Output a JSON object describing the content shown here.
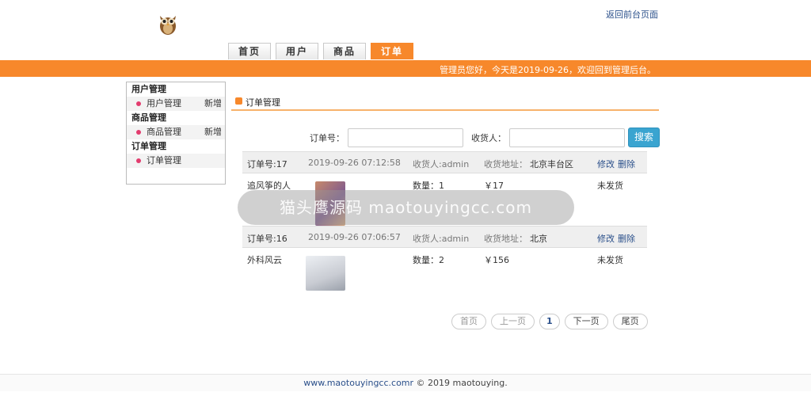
{
  "header": {
    "back_link": "返回前台页面",
    "tabs": [
      {
        "label": "首页",
        "active": false
      },
      {
        "label": "用户",
        "active": false
      },
      {
        "label": "商品",
        "active": false
      },
      {
        "label": "订单",
        "active": true
      }
    ]
  },
  "banner": {
    "greeting": "管理员您好，今天是2019-09-26，欢迎回到管理后台。",
    "color": "#f7882b"
  },
  "sidebar": {
    "sections": [
      {
        "title": "用户管理",
        "items": [
          {
            "label": "用户管理",
            "extra": "新增"
          }
        ]
      },
      {
        "title": "商品管理",
        "items": [
          {
            "label": "商品管理",
            "extra": "新增"
          }
        ]
      },
      {
        "title": "订单管理",
        "items": [
          {
            "label": "订单管理",
            "extra": ""
          }
        ]
      }
    ]
  },
  "main": {
    "title": "订单管理",
    "search": {
      "order_no_label": "订单号：",
      "receiver_label": "收货人：",
      "order_no_value": "",
      "receiver_value": "",
      "button": "搜索"
    },
    "orders": [
      {
        "order_no": "订单号:17",
        "time": "2019-09-26 07:12:58",
        "receiver": "收货人:admin",
        "address_label": "收货地址：",
        "address": "北京丰台区",
        "edit": "修改",
        "delete": "删除",
        "product": "追风筝的人",
        "quantity": "数量：1",
        "price": "￥17",
        "status": "未发货"
      },
      {
        "order_no": "订单号:16",
        "time": "2019-09-26 07:06:57",
        "receiver": "收货人:admin",
        "address_label": "收货地址：",
        "address": "北京",
        "edit": "修改",
        "delete": "删除",
        "product": "外科风云",
        "quantity": "数量：2",
        "price": "￥156",
        "status": "未发货"
      }
    ],
    "pager": {
      "first": "首页",
      "prev": "上一页",
      "current": "1",
      "next": "下一页",
      "last": "尾页"
    }
  },
  "overlay": {
    "text": "猫头鹰源码 maotouyingcc.com"
  },
  "footer": {
    "link": "www.maotouyingcc.comr",
    "copyright": " © 2019 maotouying."
  },
  "icons": {
    "logo": "owl-logo-icon",
    "title": "orange-square-icon",
    "sidebar_bullet": "pink-dot-icon"
  }
}
